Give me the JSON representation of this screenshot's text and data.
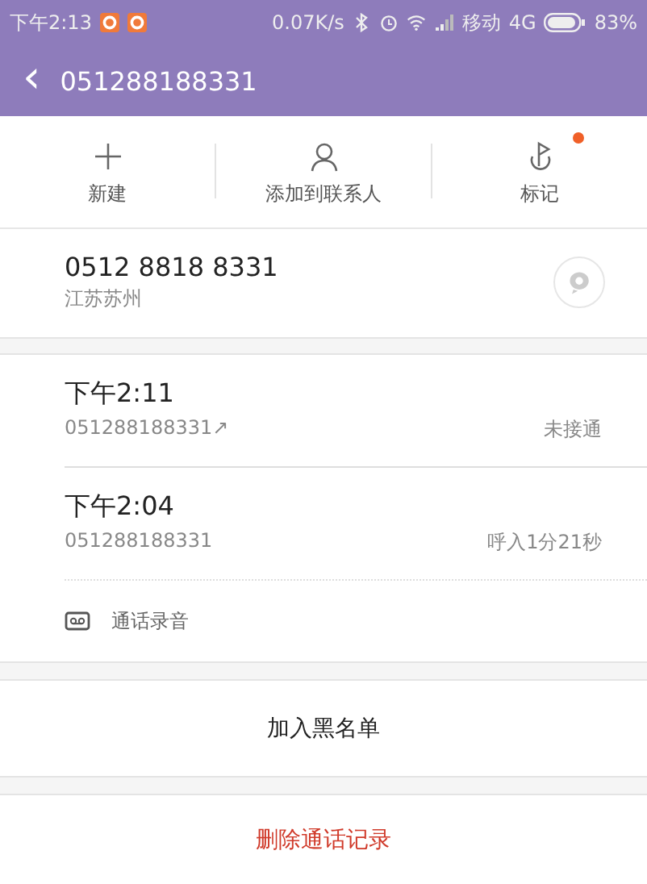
{
  "status_bar": {
    "time": "下午2:13",
    "speed": "0.07K/s",
    "carrier": "移动",
    "network": "4G",
    "battery_text": "83%"
  },
  "header": {
    "back": "‹",
    "title": "051288188331"
  },
  "actions": [
    {
      "kind": "add",
      "label": "新建",
      "badge": false
    },
    {
      "kind": "person",
      "label": "添加到联系人",
      "badge": false
    },
    {
      "kind": "flag",
      "label": "标记",
      "badge": true
    }
  ],
  "contact": {
    "number": "0512 8818 8331",
    "location": "江苏苏州"
  },
  "calls": [
    {
      "time": "下午2:11",
      "number": "051288188331",
      "arrow": "↗",
      "status": "未接通"
    },
    {
      "time": "下午2:04",
      "number": "051288188331",
      "status": "呼入1分21秒"
    }
  ],
  "recording": {
    "label": "通话录音"
  },
  "blacklist": {
    "label": "加入黑名单"
  },
  "delete": {
    "label": "删除通话记录"
  }
}
